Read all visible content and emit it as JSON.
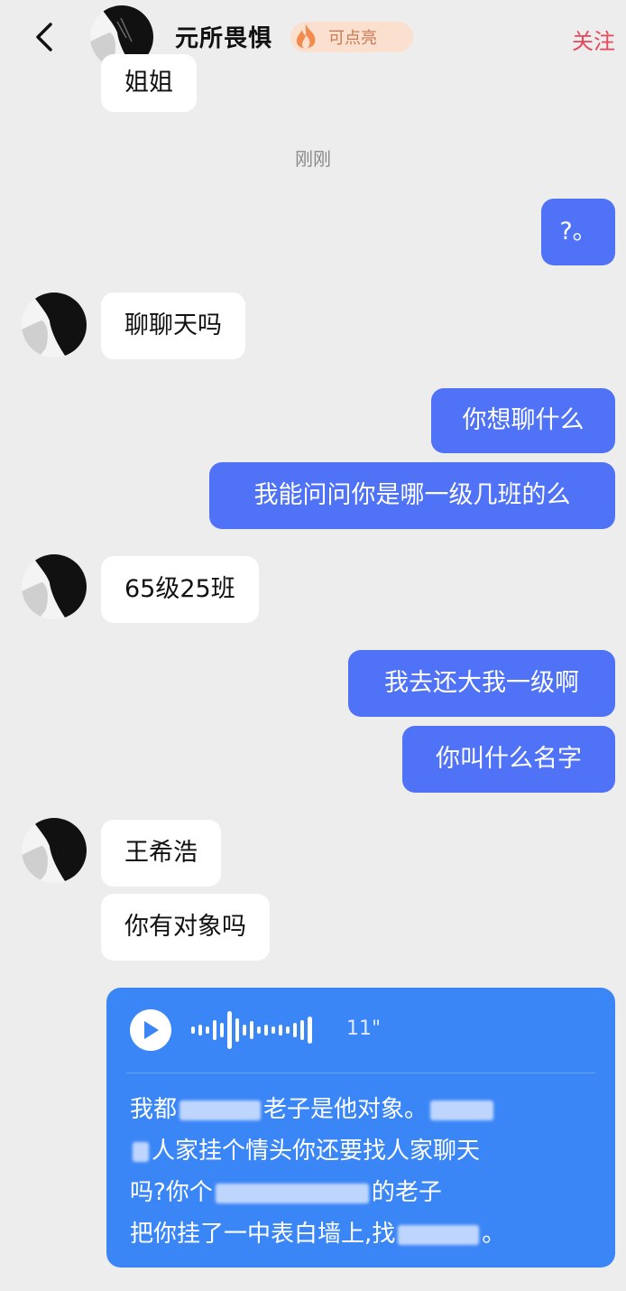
{
  "header": {
    "back_icon": "chevron-left-icon",
    "name": "元所畏惧",
    "badge_text": "可点亮",
    "badge_icon": "fire-icon",
    "follow_label": "关注"
  },
  "messages": {
    "partial_top": "姐姐",
    "timestamp": "刚刚",
    "m1": "?。",
    "m2": "聊聊天吗",
    "m3": "你想聊什么",
    "m4": "我能问问你是哪一级几班的么",
    "m5": "65级25班",
    "m6": "我去还大我一级啊",
    "m7": "你叫什么名字",
    "m8": "王希浩",
    "m9": "你有对象吗"
  },
  "voice": {
    "duration": "11\"",
    "line1_a": "我都",
    "line1_b": "老子是他对象。",
    "line2": "人家挂个情头你还要找人家聊天",
    "line3_a": "吗?你个",
    "line3_b": "的老子",
    "line4_a": "把你挂了一中表白墙上,找",
    "line4_b": "。"
  },
  "colors": {
    "background": "#ededed",
    "sent_bubble": "#4f72f6",
    "received_bubble": "#ffffff",
    "voice_card": "#3b86f6",
    "follow": "#e6475b",
    "badge_bg": "#fbe0cf"
  }
}
